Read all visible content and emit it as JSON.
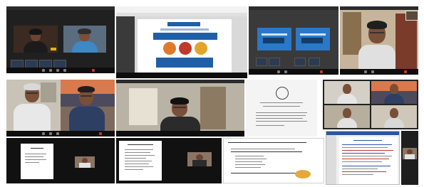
{
  "collage": {
    "tiles": [
      {
        "name": "video-call-grid-two-participants"
      },
      {
        "name": "shared-screen-event-poster"
      },
      {
        "name": "shared-screen-presentation-slides"
      },
      {
        "name": "participant-man-in-office"
      },
      {
        "name": "two-participants-mountain-background"
      },
      {
        "name": "speaker-at-desk"
      },
      {
        "name": "document-with-seal"
      },
      {
        "name": "four-participant-grid"
      },
      {
        "name": "slide-with-webcam-thumbnail-1"
      },
      {
        "name": "slide-with-webcam-thumbnail-2"
      },
      {
        "name": "slide-bulleted-text"
      },
      {
        "name": "editor-with-text-document"
      },
      {
        "name": "right-edge-participant"
      }
    ]
  },
  "colors": {
    "background": "#ffffff",
    "tile_dark": "#1a1a1a",
    "taskbar": "#0e0e0e",
    "poster_accent": "#1f5fa8",
    "poster_orange": "#e07a2a",
    "slide_blue": "#2a78c8",
    "skin": "#7a4f37",
    "shirt_white": "#e8e8e8",
    "shirt_dark": "#2d3f63"
  },
  "icons": [
    "camera-icon",
    "microphone-icon",
    "share-screen-icon",
    "participants-icon",
    "leave-call-icon"
  ]
}
